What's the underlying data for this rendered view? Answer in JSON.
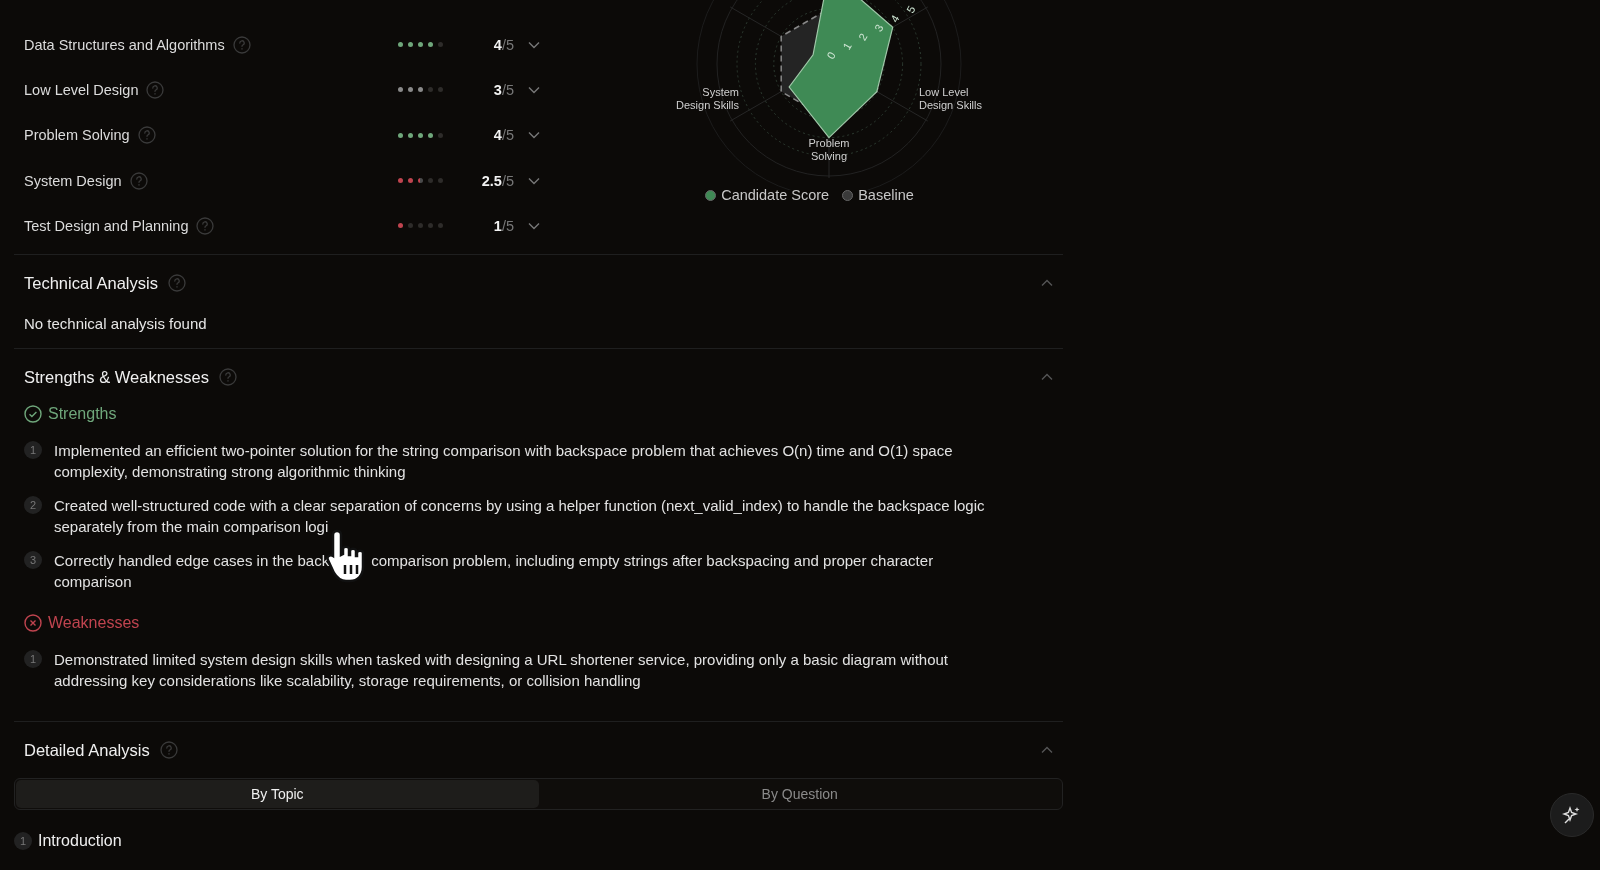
{
  "skills": [
    {
      "name": "Data Structures and Algorithms",
      "stars": 4,
      "color": "#6fa77b",
      "score": "4",
      "out_of": "/5"
    },
    {
      "name": "Low Level Design",
      "stars": 3,
      "color": "#8a8a8a",
      "score": "3",
      "out_of": "/5"
    },
    {
      "name": "Problem Solving",
      "stars": 4,
      "color": "#6fa77b",
      "score": "4",
      "out_of": "/5"
    },
    {
      "name": "System Design",
      "stars": 2.5,
      "color": "#c0444f",
      "score": "2.5",
      "out_of": "/5"
    },
    {
      "name": "Test Design and Planning",
      "stars": 1,
      "color": "#c0444f",
      "score": "1",
      "out_of": "/5"
    }
  ],
  "radar": {
    "labels": [
      {
        "lines": [
          "System",
          "Design Skills"
        ]
      },
      {
        "lines": [
          "Low Level",
          "Design Skills"
        ]
      },
      {
        "lines": [
          "Problem",
          "Solving"
        ]
      }
    ],
    "ticks": [
      "0",
      "1",
      "2",
      "3",
      "4",
      "5"
    ],
    "legend": [
      {
        "label": "Candidate Score",
        "color": "#3f8a55"
      },
      {
        "label": "Baseline",
        "color": "#3a3a3a"
      }
    ]
  },
  "technical_analysis": {
    "title": "Technical Analysis",
    "expanded": true,
    "empty_text": "No technical analysis found"
  },
  "strengths_weaknesses": {
    "title": "Strengths & Weaknesses",
    "expanded": true,
    "groups": [
      {
        "kind": "strengths",
        "title": "Strengths",
        "items": [
          {
            "number": "1",
            "parts": [
              "Implemented an efficient two-pointer solution for the string comparison with backspace problem that achieves O(n) time and O(1) space complexity, demonstrating strong algorithmic thinking"
            ]
          },
          {
            "number": "2",
            "parts": [
              "Created well-structured code with a clear separation of concerns by using a helper function (next_valid_index) to handle the backspace logic separately from the main comparison logi"
            ]
          },
          {
            "number": "3",
            "parts": [
              "Correctly handled edge cases in the back",
              "comparison problem, including empty strings after backspacing and proper character comparison"
            ]
          }
        ]
      },
      {
        "kind": "weaknesses",
        "title": "Weaknesses",
        "items": [
          {
            "number": "1",
            "parts": [
              "Demonstrated limited system design skills when tasked with designing a URL shortener service, providing only a basic diagram without addressing key considerations like scalability, storage requirements, or collision handling"
            ]
          }
        ]
      }
    ]
  },
  "detailed_analysis": {
    "title": "Detailed Analysis",
    "expanded": true,
    "tabs": [
      {
        "label": "By Topic",
        "selected": true
      },
      {
        "label": "By Question",
        "selected": false
      }
    ],
    "topics": [
      {
        "number": "1",
        "title": "Introduction"
      }
    ]
  }
}
